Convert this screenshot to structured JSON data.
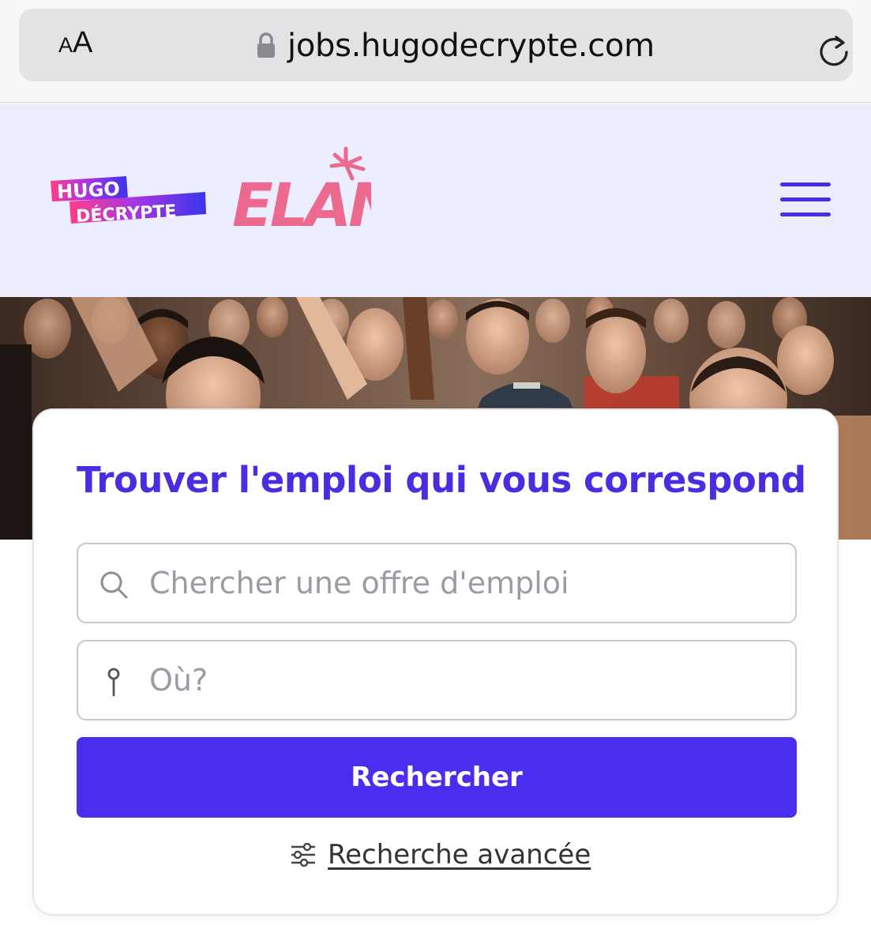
{
  "browser": {
    "text_size_small": "A",
    "text_size_large": "A",
    "url": "jobs.hugodecrypte.com",
    "icons": [
      "lock-icon",
      "reload-icon"
    ]
  },
  "header": {
    "logo_hugo_line1": "HUGO",
    "logo_hugo_line2": "DÉCRYPTE",
    "logo_elan": "ELAN",
    "icons": [
      "menu-icon"
    ]
  },
  "search": {
    "title": "Trouver l'emploi qui vous correspond",
    "job_placeholder": "Chercher une offre d'emploi",
    "job_value": "",
    "location_placeholder": "Où?",
    "location_value": "",
    "submit_label": "Rechercher",
    "advanced_label": "Recherche avancée",
    "icons": [
      "search-icon",
      "location-pin-icon",
      "filter-sliders-icon"
    ]
  },
  "colors": {
    "brand_purple": "#4a2de0",
    "button_purple": "#4a2ef0",
    "header_bg": "#eceeff",
    "elan_pink": "#ec6a8e"
  }
}
